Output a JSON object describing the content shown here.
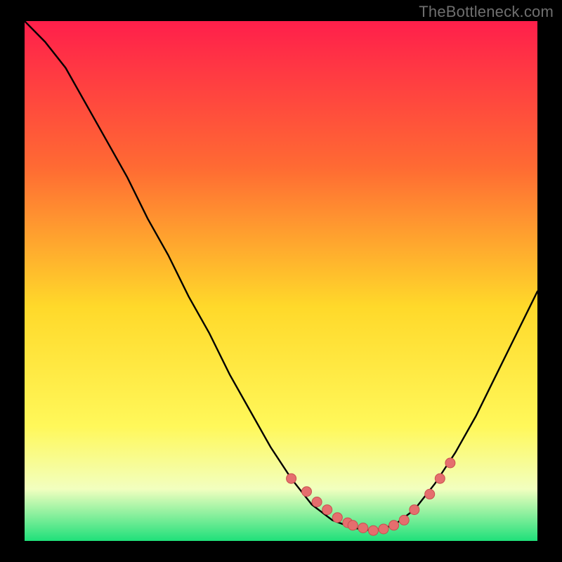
{
  "attribution": "TheBottleneck.com",
  "colors": {
    "background": "#000000",
    "gradient_top": "#ff1f4b",
    "gradient_mid_upper": "#ff8a2a",
    "gradient_mid": "#ffd92a",
    "gradient_mid_lower": "#fff85a",
    "gradient_pale": "#f2ffbf",
    "gradient_bottom": "#1fe07a",
    "curve": "#000000",
    "marker_fill": "#e56e6e",
    "marker_stroke": "#c94f4f",
    "attribution_text": "#6f6f6f"
  },
  "chart_data": {
    "type": "line",
    "title": "",
    "xlabel": "",
    "ylabel": "",
    "xlim": [
      0,
      100
    ],
    "ylim": [
      0,
      100
    ],
    "series": [
      {
        "name": "bottleneck-curve",
        "x": [
          0,
          4,
          8,
          12,
          16,
          20,
          24,
          28,
          32,
          36,
          40,
          44,
          48,
          52,
          56,
          60,
          64,
          68,
          72,
          76,
          80,
          84,
          88,
          92,
          96,
          100
        ],
        "y": [
          100,
          96,
          91,
          84,
          77,
          70,
          62,
          55,
          47,
          40,
          32,
          25,
          18,
          12,
          7,
          4,
          2.5,
          2,
          3,
          6,
          11,
          17,
          24,
          32,
          40,
          48
        ]
      }
    ],
    "markers": {
      "name": "highlight-dots",
      "x": [
        52,
        55,
        57,
        59,
        61,
        63,
        64,
        66,
        68,
        70,
        72,
        74,
        76,
        79,
        81,
        83
      ],
      "y": [
        12,
        9.5,
        7.5,
        6,
        4.5,
        3.5,
        3,
        2.5,
        2,
        2.3,
        3,
        4,
        6,
        9,
        12,
        15
      ]
    }
  }
}
